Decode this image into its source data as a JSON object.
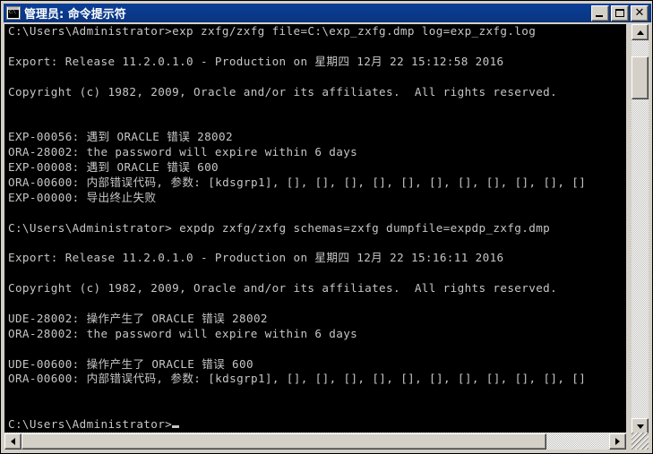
{
  "window": {
    "title": "管理员: 命令提示符",
    "icon": "console-window-icon",
    "icon_text": "C:\\",
    "caption_buttons": [
      {
        "name": "minimize",
        "label": "_"
      },
      {
        "name": "maximize",
        "label": "□"
      },
      {
        "name": "close",
        "label": "X"
      }
    ],
    "colors": {
      "titlebar": "#0a3a8d",
      "titlebar_text": "#ffffff",
      "chrome": "#d4d0c8",
      "console_bg": "#000000",
      "console_fg": "#c6c6c6"
    }
  },
  "console": {
    "lines": [
      "C:\\Users\\Administrator>exp zxfg/zxfg file=C:\\exp_zxfg.dmp log=exp_zxfg.log",
      "",
      "Export: Release 11.2.0.1.0 - Production on 星期四 12月 22 15:12:58 2016",
      "",
      "Copyright (c) 1982, 2009, Oracle and/or its affiliates.  All rights reserved.",
      "",
      "",
      "EXP-00056: 遇到 ORACLE 错误 28002",
      "ORA-28002: the password will expire within 6 days",
      "EXP-00008: 遇到 ORACLE 错误 600",
      "ORA-00600: 内部错误代码, 参数: [kdsgrp1], [], [], [], [], [], [], [], [], [], [], []",
      "EXP-00000: 导出终止失败",
      "",
      "C:\\Users\\Administrator> expdp zxfg/zxfg schemas=zxfg dumpfile=expdp_zxfg.dmp",
      "",
      "Export: Release 11.2.0.1.0 - Production on 星期四 12月 22 15:16:11 2016",
      "",
      "Copyright (c) 1982, 2009, Oracle and/or its affiliates.  All rights reserved.",
      "",
      "UDE-28002: 操作产生了 ORACLE 错误 28002",
      "ORA-28002: the password will expire within 6 days",
      "",
      "UDE-00600: 操作产生了 ORACLE 错误 600",
      "ORA-00600: 内部错误代码, 参数: [kdsgrp1], [], [], [], [], [], [], [], [], [], [], []",
      "",
      "",
      "C:\\Users\\Administrator>"
    ],
    "prompt_cursor": "_"
  },
  "scrollbars": {
    "vertical": {
      "up_arrow": "▲",
      "down_arrow": "▼"
    },
    "horizontal": {
      "left_arrow": "◀",
      "right_arrow": "▶"
    }
  }
}
